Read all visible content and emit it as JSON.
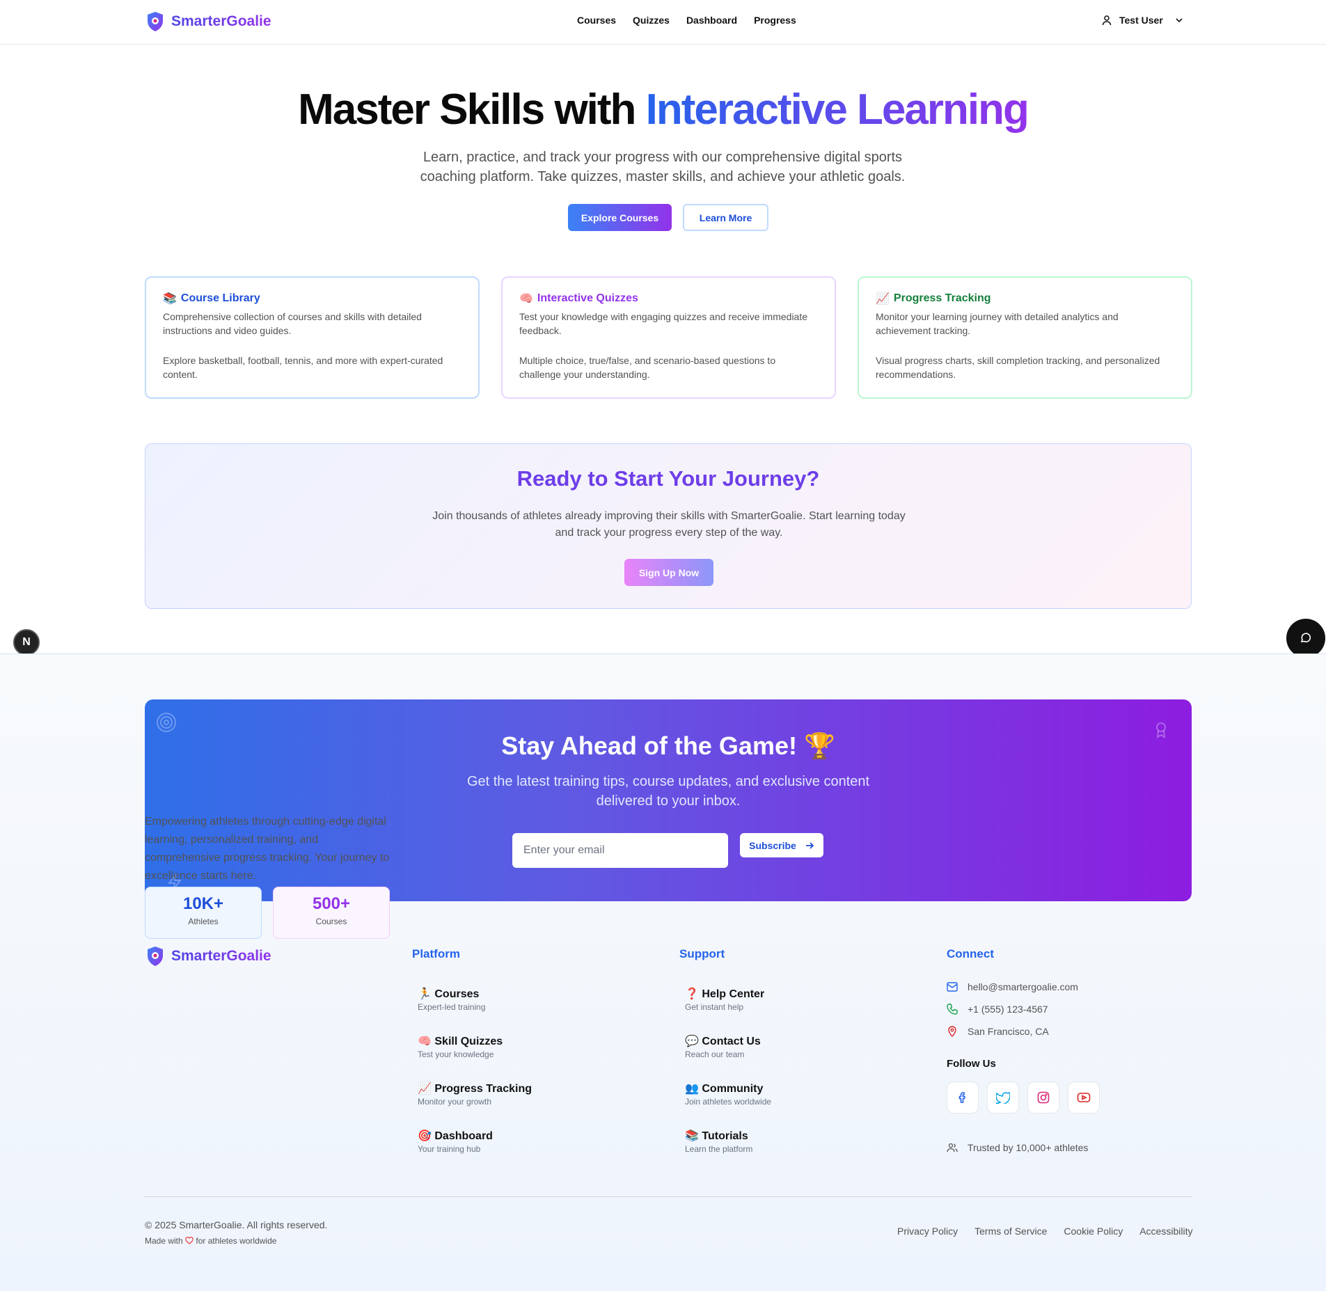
{
  "header": {
    "brand": "SmarterGoalie",
    "nav": [
      "Courses",
      "Quizzes",
      "Dashboard",
      "Progress"
    ],
    "user": "Test User"
  },
  "hero": {
    "title_plain": "Master Skills with",
    "title_accent": "Interactive Learning",
    "subtitle": "Learn, practice, and track your progress with our comprehensive digital sports coaching platform. Take quizzes, master skills, and achieve your athletic goals.",
    "primary_button": "Explore Courses",
    "secondary_button": "Learn More"
  },
  "features": [
    {
      "emoji": "📚",
      "title": "Course Library",
      "color": "#1d4ed8",
      "border": "#bfdbfe",
      "desc": "Comprehensive collection of courses and skills with detailed instructions and video guides.",
      "detail": "Explore basketball, football, tennis, and more with expert-curated content."
    },
    {
      "emoji": "🧠",
      "title": "Interactive Quizzes",
      "color": "#9333ea",
      "border": "#e9d5ff",
      "desc": "Test your knowledge with engaging quizzes and receive immediate feedback.",
      "detail": "Multiple choice, true/false, and scenario-based questions to challenge your understanding."
    },
    {
      "emoji": "📈",
      "title": "Progress Tracking",
      "color": "#15803d",
      "border": "#bbf7d0",
      "desc": "Monitor your learning journey with detailed analytics and achievement tracking.",
      "detail": "Visual progress charts, skill completion tracking, and personalized recommendations."
    }
  ],
  "journey": {
    "title": "Ready to Start Your Journey?",
    "text": "Join thousands of athletes already improving their skills with SmarterGoalie. Start learning today and track your progress every step of the way.",
    "button": "Sign Up Now"
  },
  "newsletter": {
    "title": "Stay Ahead of the Game! 🏆",
    "text": "Get the latest training tips, course updates, and exclusive content delivered to your inbox.",
    "placeholder": "Enter your email",
    "button": "Subscribe"
  },
  "footer": {
    "brand": "SmarterGoalie",
    "description": "Empowering athletes through cutting-edge digital learning, personalized training, and comprehensive progress tracking. Your journey to excellence starts here.",
    "stats": [
      {
        "value": "10K+",
        "label": "Athletes",
        "color": "#1d4ed8"
      },
      {
        "value": "500+",
        "label": "Courses",
        "color": "#9333ea"
      }
    ],
    "platform": {
      "heading": "Platform",
      "links": [
        {
          "emoji": "🏃",
          "title": "Courses",
          "sub": "Expert-led training"
        },
        {
          "emoji": "🧠",
          "title": "Skill Quizzes",
          "sub": "Test your knowledge"
        },
        {
          "emoji": "📈",
          "title": "Progress Tracking",
          "sub": "Monitor your growth"
        },
        {
          "emoji": "🎯",
          "title": "Dashboard",
          "sub": "Your training hub"
        }
      ]
    },
    "support": {
      "heading": "Support",
      "links": [
        {
          "emoji": "❓",
          "title": "Help Center",
          "sub": "Get instant help"
        },
        {
          "emoji": "💬",
          "title": "Contact Us",
          "sub": "Reach our team"
        },
        {
          "emoji": "👥",
          "title": "Community",
          "sub": "Join athletes worldwide"
        },
        {
          "emoji": "📚",
          "title": "Tutorials",
          "sub": "Learn the platform"
        }
      ]
    },
    "connect": {
      "heading": "Connect",
      "email": "hello@smartergoalie.com",
      "phone": "+1 (555) 123-4567",
      "location": "San Francisco, CA",
      "follow": "Follow Us",
      "trusted": "Trusted by 10,000+ athletes"
    },
    "copyright": "© 2025 SmarterGoalie. All rights reserved.",
    "made_pre": "Made with",
    "made_post": "for athletes worldwide",
    "legal": [
      "Privacy Policy",
      "Terms of Service",
      "Cookie Policy",
      "Accessibility"
    ]
  },
  "floating": {
    "badge": "N"
  }
}
